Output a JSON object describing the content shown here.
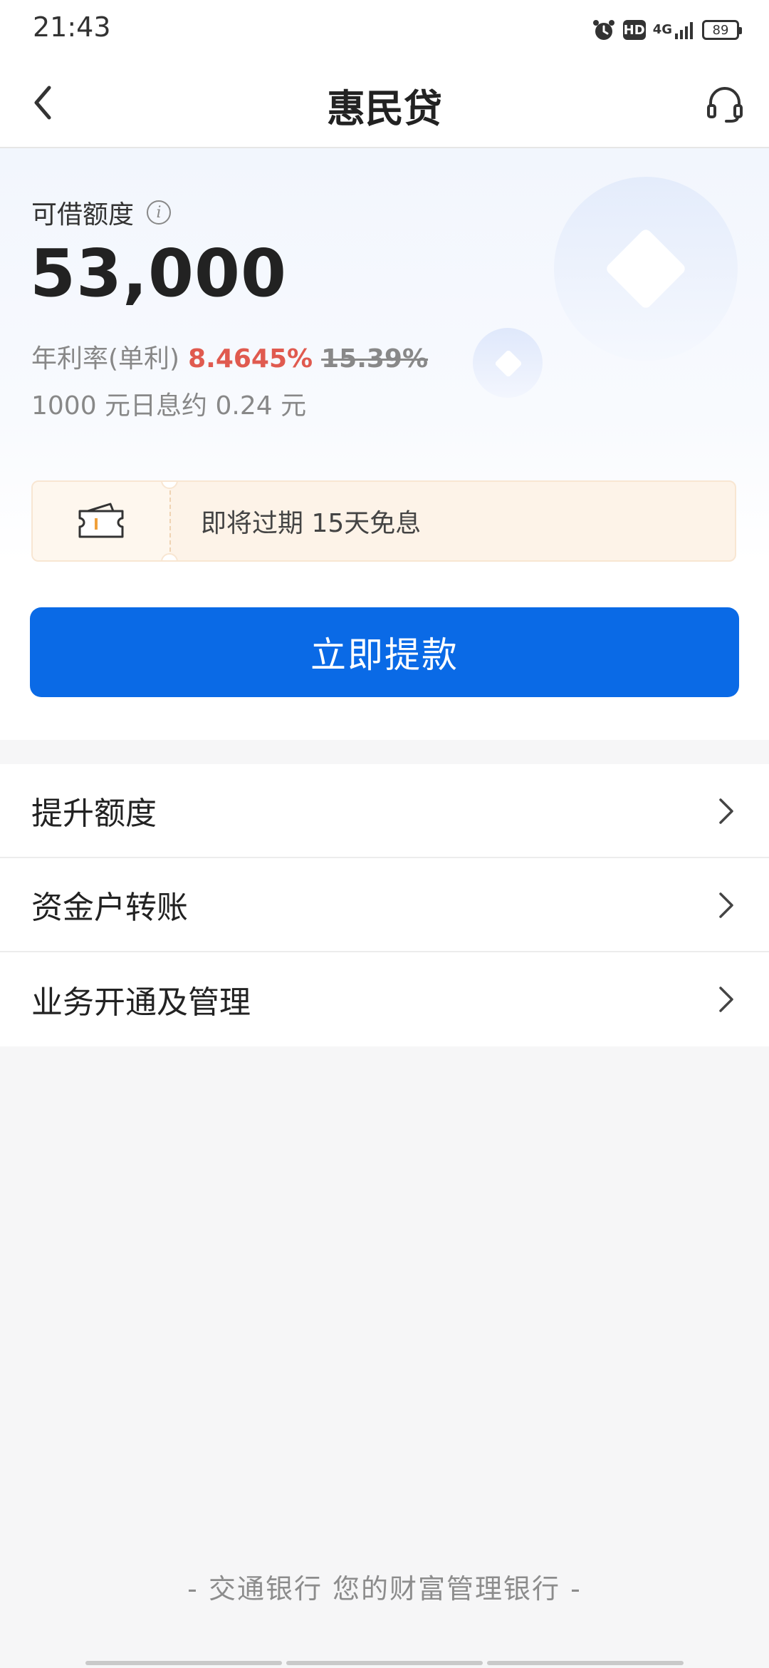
{
  "status_bar": {
    "time": "21:43",
    "hd_label": "HD",
    "network_label": "4G",
    "battery": "89"
  },
  "nav": {
    "title": "惠民贷"
  },
  "credit": {
    "label": "可借额度",
    "amount": "53,000",
    "rate_label": "年利率(单利)",
    "rate_current": "8.4645%",
    "rate_original": "15.39%",
    "daily_interest": "1000 元日息约 0.24 元"
  },
  "coupon": {
    "text": "即将过期 15天免息"
  },
  "cta": {
    "label": "立即提款"
  },
  "menu": {
    "items": [
      {
        "label": "提升额度"
      },
      {
        "label": "资金户转账"
      },
      {
        "label": "业务开通及管理"
      }
    ]
  },
  "footer": {
    "slogan": "- 交通银行 您的财富管理银行 -"
  },
  "colors": {
    "primary": "#0a6ae6",
    "rate_red": "#e05a4f",
    "coupon_bg": "#fdf3e8",
    "coupon_accent": "#f0a03a"
  }
}
